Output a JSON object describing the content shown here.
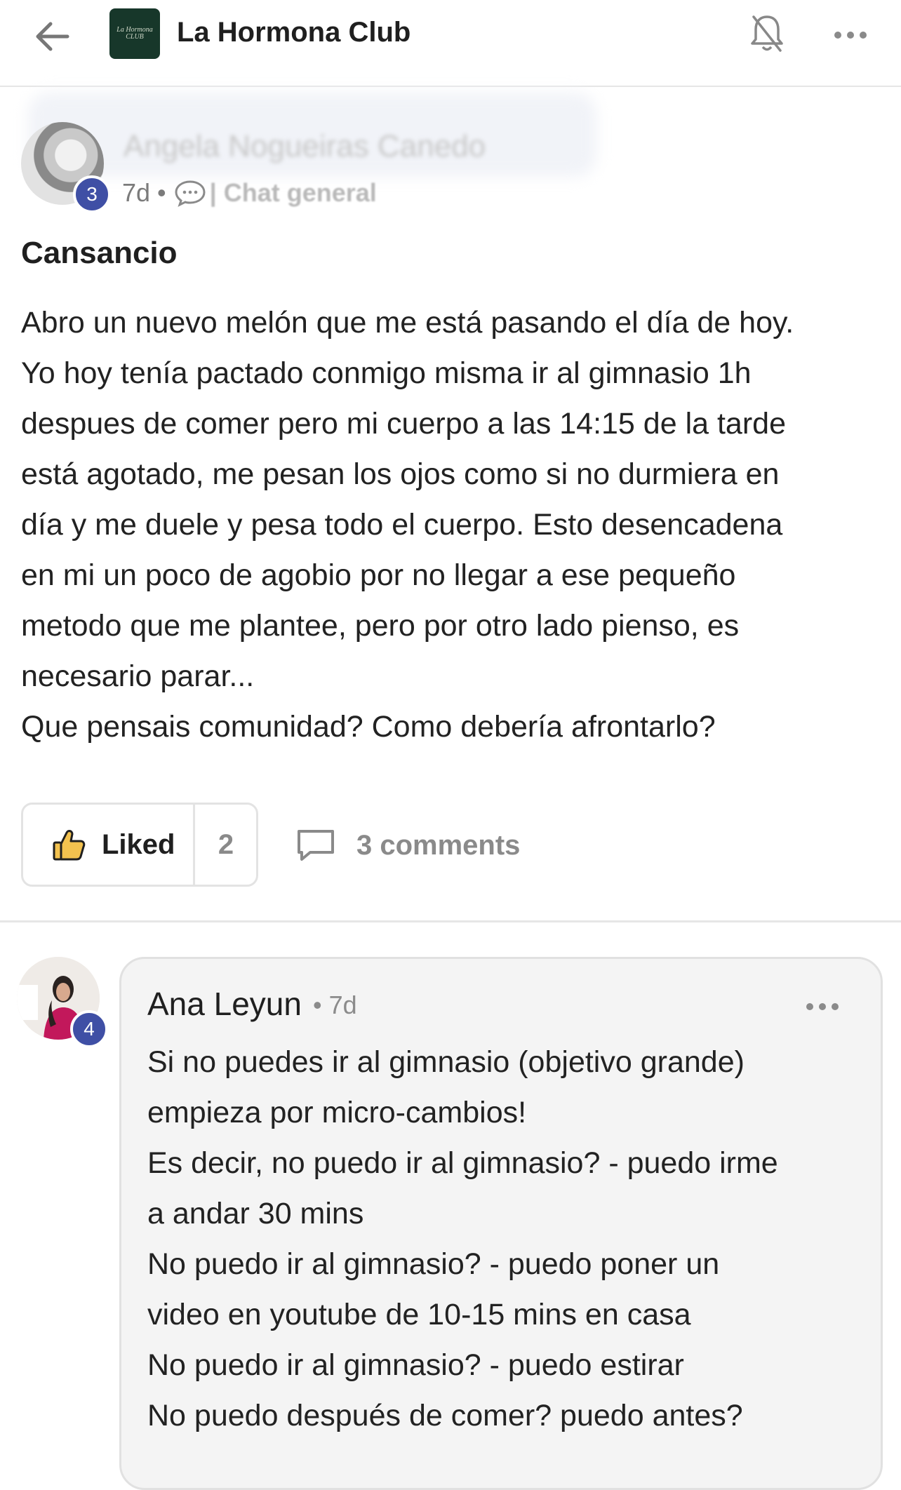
{
  "header": {
    "club_name": "La Hormona Club",
    "logo_text": "La Hormona CLUB"
  },
  "post": {
    "author_name": "Angela Nogueiras Canedo",
    "author_level": "3",
    "time": "7d",
    "separator": "•",
    "channel": "| Chat general",
    "title": "Cansancio",
    "body": [
      "Abro un nuevo melón que me está pasando el día de hoy.",
      "Yo hoy tenía pactado conmigo misma ir al gimnasio 1h",
      "despues de comer pero mi cuerpo a las 14:15 de la tarde",
      "está agotado, me pesan los ojos como si no durmiera en",
      "día y me duele y pesa todo el cuerpo. Esto desencadena",
      "en mi un poco de agobio por no llegar a ese pequeño",
      "metodo que me plantee, pero por otro lado pienso, es",
      "necesario parar...",
      "Que pensais comunidad? Como debería afrontarlo?"
    ],
    "like_label": "Liked",
    "like_count": "2",
    "comments_label": "3 comments"
  },
  "comment": {
    "author": "Ana Leyun",
    "author_level": "4",
    "time": "• 7d",
    "body": [
      "Si no puedes ir al gimnasio (objetivo grande)",
      "empieza por micro-cambios!",
      "Es decir, no puedo ir al gimnasio? - puedo irme",
      "a andar 30 mins",
      "No puedo ir al gimnasio? - puedo poner un",
      "video en youtube de 10-15 mins en casa",
      "No puedo ir al gimnasio? - puedo estirar",
      "No puedo después de comer? puedo antes?"
    ]
  },
  "colors": {
    "badge": "#3f4fa5",
    "logo_bg": "#17372a",
    "muted_text": "#8a8a8a"
  },
  "icons": [
    "back-arrow-icon",
    "bell-off-icon",
    "more-horizontal-icon",
    "chat-bubble-icon",
    "thumbs-up-icon",
    "comment-icon"
  ]
}
